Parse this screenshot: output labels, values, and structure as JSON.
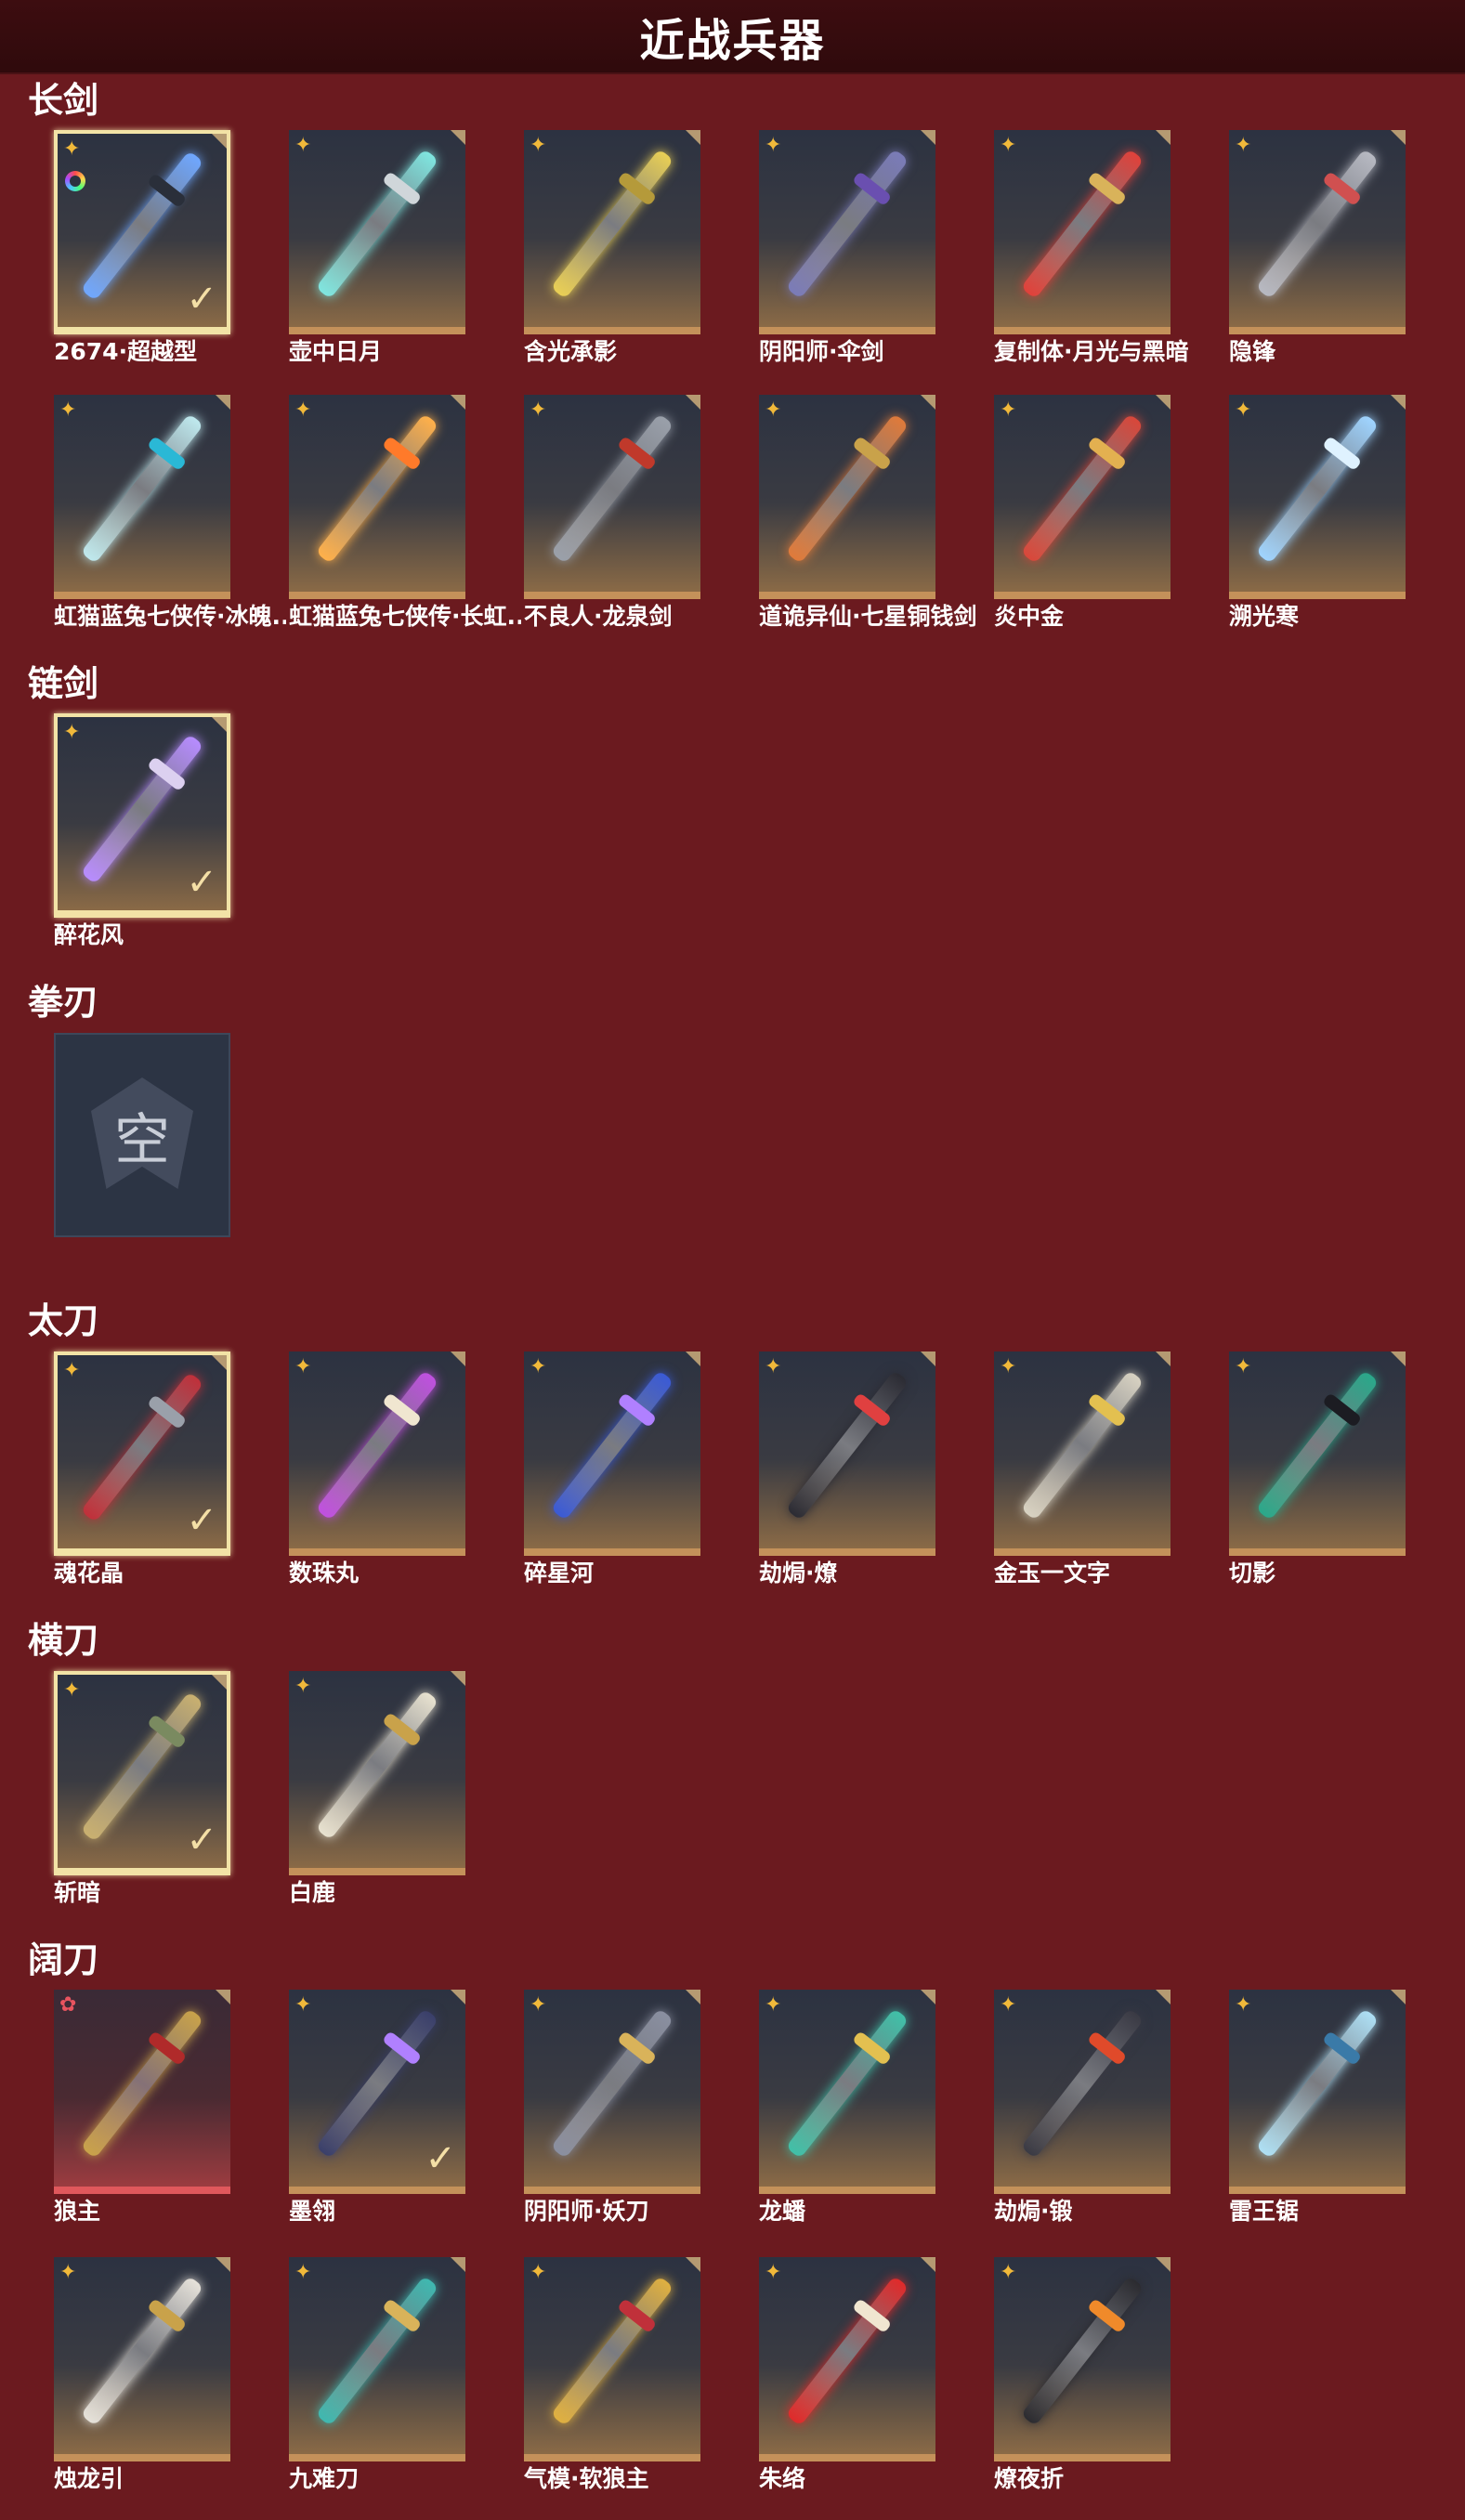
{
  "header": {
    "title": "近战兵器"
  },
  "sections": [
    {
      "title": "长剑",
      "items": [
        {
          "name": "2674·超越型",
          "selected": true,
          "rarity": "gold",
          "color": "#6fa7ff",
          "hilt": "#2a2f3a",
          "extra": "ring"
        },
        {
          "name": "壶中日月",
          "rarity": "gold",
          "color": "#7fe6e0",
          "hilt": "#d0d6da"
        },
        {
          "name": "含光承影",
          "rarity": "gold",
          "color": "#e9cf55",
          "hilt": "#b59a3a"
        },
        {
          "name": "阴阳师·伞剑",
          "rarity": "gold",
          "color": "#7a7bb8",
          "hilt": "#6a4fb0"
        },
        {
          "name": "复制体·月光与黑暗",
          "rarity": "gold",
          "color": "#e0413a",
          "hilt": "#d9b35a"
        },
        {
          "name": "隐锋",
          "rarity": "gold",
          "color": "#b7b9c2",
          "hilt": "#d05050"
        },
        {
          "name": "虹猫蓝兔七侠传·冰魄...",
          "rarity": "gold",
          "color": "#bfe9ee",
          "hilt": "#2ab8d6"
        },
        {
          "name": "虹猫蓝兔七侠传·长虹...",
          "rarity": "gold",
          "color": "#ffb04a",
          "hilt": "#ff7a2a"
        },
        {
          "name": "不良人·龙泉剑",
          "rarity": "gold",
          "color": "#9aa0aa",
          "hilt": "#c0392b"
        },
        {
          "name": "道诡异仙·七星铜钱剑",
          "rarity": "gold",
          "color": "#e07a3a",
          "hilt": "#c9a24a"
        },
        {
          "name": "炎中金",
          "rarity": "gold",
          "color": "#d9473a",
          "hilt": "#e3b050"
        },
        {
          "name": "溯光寒",
          "rarity": "gold",
          "color": "#9fd4ff",
          "hilt": "#dff2ff"
        }
      ]
    },
    {
      "title": "链剑",
      "items": [
        {
          "name": "醉花风",
          "selected": true,
          "rarity": "gold",
          "color": "#b78cff",
          "hilt": "#dcd0f0"
        }
      ]
    },
    {
      "title": "拳刃",
      "items": [
        {
          "empty": true,
          "glyph": "空"
        }
      ]
    },
    {
      "title": "太刀",
      "items": [
        {
          "name": "魂花晶",
          "selected": true,
          "rarity": "gold",
          "color": "#c0303a",
          "hilt": "#9aa0aa"
        },
        {
          "name": "数珠丸",
          "rarity": "gold",
          "color": "#c050e0",
          "hilt": "#f0e6d0"
        },
        {
          "name": "碎星河",
          "rarity": "gold",
          "color": "#3a5ad6",
          "hilt": "#b080ff"
        },
        {
          "name": "劫焗·燎",
          "rarity": "gold",
          "color": "#2b2b33",
          "hilt": "#e04040"
        },
        {
          "name": "金玉一文字",
          "rarity": "gold",
          "color": "#d8d2c2",
          "hilt": "#e3c050"
        },
        {
          "name": "切影",
          "rarity": "gold",
          "color": "#2aa88a",
          "hilt": "#1c1c22"
        }
      ]
    },
    {
      "title": "横刀",
      "items": [
        {
          "name": "斩暗",
          "selected": true,
          "rarity": "gold",
          "color": "#c9b070",
          "hilt": "#7a8a60"
        },
        {
          "name": "白鹿",
          "rarity": "gold",
          "color": "#e8e2d0",
          "hilt": "#c9a24a"
        }
      ]
    },
    {
      "title": "阔刀",
      "items": [
        {
          "name": "狼主",
          "rarity": "red",
          "color": "#c9a24a",
          "hilt": "#b02a2a",
          "redBottom": true
        },
        {
          "name": "墨翎",
          "checked": true,
          "rarity": "gold",
          "color": "#3a3f6a",
          "hilt": "#b080ff"
        },
        {
          "name": "阴阳师·妖刀",
          "rarity": "gold",
          "color": "#8a8fa0",
          "hilt": "#d9b35a"
        },
        {
          "name": "龙蟠",
          "rarity": "gold",
          "color": "#40c0a8",
          "hilt": "#e3c050"
        },
        {
          "name": "劫焗·锻",
          "rarity": "gold",
          "color": "#3a3a44",
          "hilt": "#e04a2a"
        },
        {
          "name": "雷王锯",
          "rarity": "gold",
          "color": "#aee0f5",
          "hilt": "#3a7aa8"
        },
        {
          "name": "烛龙引",
          "rarity": "gold",
          "color": "#e6e2da",
          "hilt": "#c9a24a"
        },
        {
          "name": "九难刀",
          "rarity": "gold",
          "color": "#3fb8b0",
          "hilt": "#d9b35a"
        },
        {
          "name": "气模·软狼主",
          "rarity": "gold",
          "color": "#e0b040",
          "hilt": "#c0303a"
        },
        {
          "name": "朱络",
          "rarity": "gold",
          "color": "#e02a2a",
          "hilt": "#f0e6d0"
        },
        {
          "name": "燎夜折",
          "rarity": "gold",
          "color": "#2b2b30",
          "hilt": "#f08a2a"
        }
      ]
    }
  ]
}
